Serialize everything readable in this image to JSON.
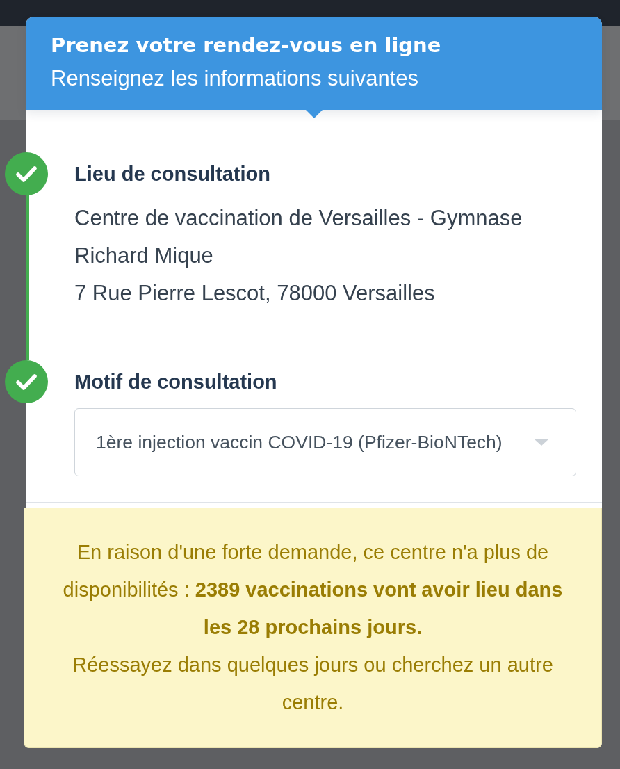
{
  "dialog": {
    "title": "Prenez votre rendez-vous en ligne",
    "subtitle": "Renseignez les informations suivantes"
  },
  "steps": [
    {
      "kind": "info",
      "heading": "Lieu de consultation",
      "completed": true,
      "lines": [
        "Centre de vaccination de Versailles - Gymnase Richard Mique",
        "7 Rue Pierre Lescot, 78000 Versailles"
      ]
    },
    {
      "kind": "select",
      "heading": "Motif de consultation",
      "completed": true,
      "value": "1ère injection vaccin COVID-19 (Pfizer-BioNTech)"
    }
  ],
  "notice": {
    "paragraphs": [
      "En raison d'une forte demande, ce centre n'a plus de disponibilités : **2389 vaccinations vont avoir lieu dans les 28 prochains jours.**",
      "Réessayez dans quelques jours ou cherchez un autre centre."
    ]
  }
}
